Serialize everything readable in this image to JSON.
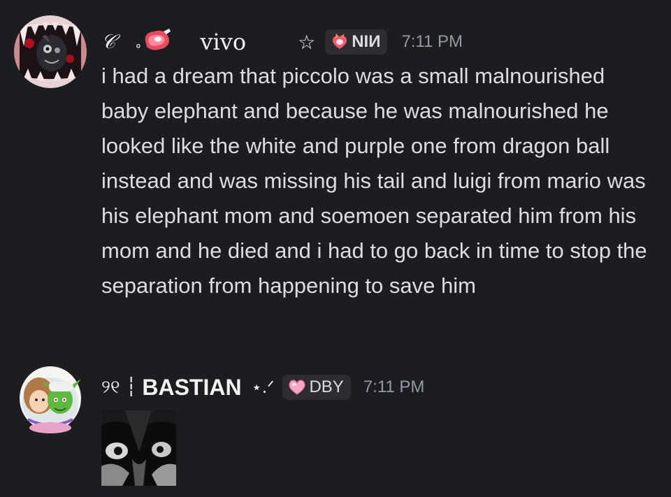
{
  "messages": [
    {
      "author": {
        "prefix": "𝒞",
        "name": "vivo",
        "suffix": "☆",
        "avatar": "fanged-creature-avatar"
      },
      "tag": {
        "icon": "fire-heart-icon",
        "label": "NIИ"
      },
      "timestamp": "7:11 PM",
      "content": "i had a dream that piccolo was a small malnourished baby elephant and because he was malnourished he looked like the white and purple one from dragon ball instead and was missing his tail and luigi from mario was his elephant mom and soemoen separated him from his mom and he died and i had to go back in time to stop the separation from happening to save him"
    },
    {
      "author": {
        "prefix": "୨୧ ┆",
        "name": "BASTIAN",
        "suffix": "⋆.ᐟ",
        "avatar": "anime-duo-avatar"
      },
      "tag": {
        "icon": "pink-heart-icon",
        "label": "DBY"
      },
      "timestamp": "7:11 PM",
      "attachment": "dark-face-image"
    }
  ],
  "colors": {
    "background": "#1c1d21",
    "text": "#dbdee1",
    "username": "#f2f3f5",
    "timestamp": "#949ba4",
    "tag_bg": "#2b2d31"
  }
}
